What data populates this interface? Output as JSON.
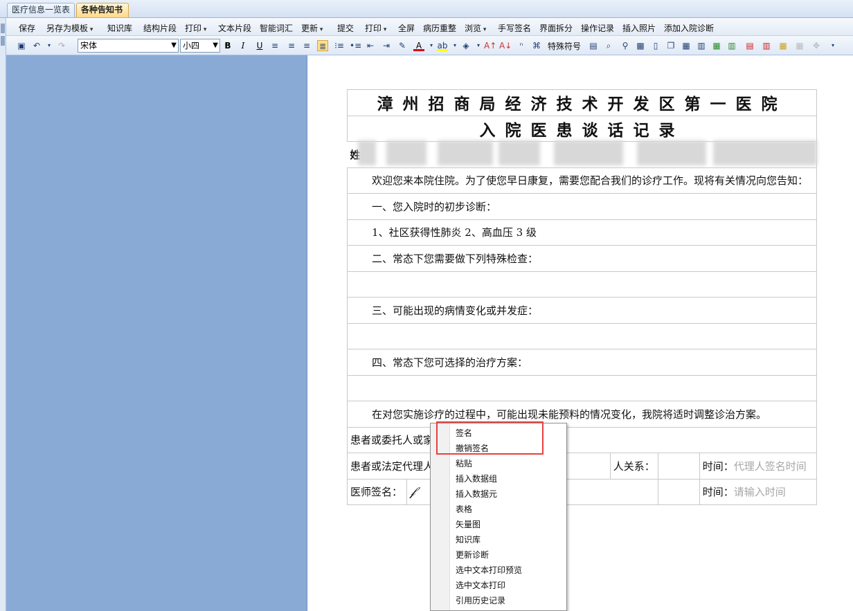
{
  "tabs": [
    {
      "label": "医疗信息一览表",
      "active": false
    },
    {
      "label": "各种告知书",
      "active": true
    }
  ],
  "menu": [
    "保存",
    "另存为模板",
    "知识库",
    "结构片段",
    "打印",
    "文本片段",
    "智能词汇",
    "更新",
    "提交",
    "打印",
    "全屏",
    "病历重整",
    "浏览",
    "手写签名",
    "界面拆分",
    "操作记录",
    "插入照片",
    "添加入院诊断"
  ],
  "toolbar": {
    "font": "宋体",
    "size": "小四",
    "special_symbol": "特殊符号",
    "bold": "B",
    "italic": "I",
    "underline": "U"
  },
  "doc": {
    "hospital": "漳州招商局经济技术开发区第一医院",
    "title": "入院医患谈话记录",
    "name_prefix": "姓",
    "intro": "欢迎您来本院住院。为了使您早日康复，需要您配合我们的诊疗工作。现将有关情况向您告知：",
    "s1": "一、您入院时的初步诊断：",
    "s1_content": "1、社区获得性肺炎 2、高血压 3 级",
    "s2": "二、常态下您需要做下列特殊检查：",
    "s3": "三、可能出现的病情变化或并发症：",
    "s4": "四、常态下您可选择的治疗方案：",
    "s5": "在对您实施诊疗的过程中，可能出现未能预料的情况变化，我院将适时调整诊治方案。",
    "patient_or_trustee": "患者或委托人或家",
    "legal_rep": "患者或法定代理人",
    "relation": "人关系：",
    "time_label": "时间：",
    "rep_sign_time_placeholder": "代理人签名时间",
    "doctor_sign": "医师签名：",
    "input_time_placeholder": "请输入时间"
  },
  "context_menu": [
    "签名",
    "撤销签名",
    "粘贴",
    "插入数据组",
    "插入数据元",
    "表格",
    "矢量图",
    "知识库",
    "更新诊断",
    "选中文本打印预览",
    "选中文本打印",
    "引用历史记录"
  ]
}
